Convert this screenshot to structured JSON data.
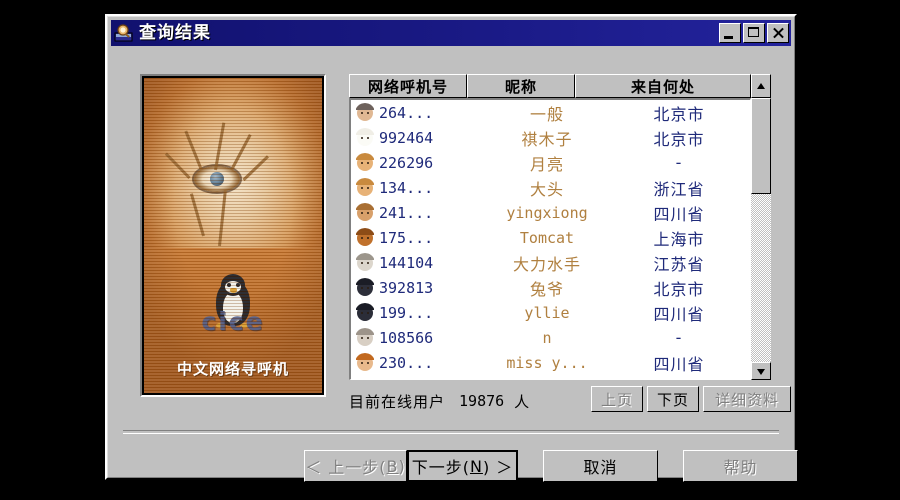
{
  "window": {
    "title": "查询结果",
    "icon": "search-book-icon",
    "controls": {
      "minimize": "minimize-icon",
      "maximize": "maximize-icon",
      "close": "close-icon"
    }
  },
  "art_panel": {
    "caption": "中文网络寻呼机",
    "logo_text": "cice",
    "mascot": "penguin-icon"
  },
  "table": {
    "headers": [
      "网络呼机号",
      "昵称",
      "来自何处"
    ],
    "sort_button": "sort-ascending-icon",
    "rows": [
      {
        "avatar": "avatar-face-icon",
        "id": "264...",
        "nick": "一般",
        "nick_cjk": true,
        "from": "北京市"
      },
      {
        "avatar": "avatar-cat-icon",
        "id": "992464",
        "nick": "祺木子",
        "nick_cjk": true,
        "from": "北京市"
      },
      {
        "avatar": "avatar-bear-icon",
        "id": "226296",
        "nick": "月亮",
        "nick_cjk": true,
        "from": "-"
      },
      {
        "avatar": "avatar-bear-icon",
        "id": "134...",
        "nick": "大头",
        "nick_cjk": true,
        "from": "浙江省"
      },
      {
        "avatar": "avatar-dog-icon",
        "id": "241...",
        "nick": "yingxiong",
        "nick_cjk": false,
        "from": "四川省"
      },
      {
        "avatar": "avatar-lion-icon",
        "id": "175...",
        "nick": "Tomcat",
        "nick_cjk": false,
        "from": "上海市"
      },
      {
        "avatar": "avatar-man-icon",
        "id": "144104",
        "nick": "大力水手",
        "nick_cjk": true,
        "from": "江苏省"
      },
      {
        "avatar": "avatar-bug-icon",
        "id": "392813",
        "nick": "兔爷",
        "nick_cjk": true,
        "from": "北京市"
      },
      {
        "avatar": "avatar-cow-icon",
        "id": "199...",
        "nick": "yllie",
        "nick_cjk": false,
        "from": "四川省"
      },
      {
        "avatar": "avatar-gray-icon",
        "id": "108566",
        "nick": "n",
        "nick_cjk": false,
        "from": "-"
      },
      {
        "avatar": "avatar-girl-icon",
        "id": "230...",
        "nick": "miss y...",
        "nick_cjk": false,
        "from": "四川省"
      }
    ]
  },
  "status": {
    "label": "目前在线用户",
    "count": "19876",
    "unit": "人"
  },
  "page_buttons": {
    "prev": "上页",
    "next": "下页",
    "details": "详细资料"
  },
  "dialog_buttons": {
    "back_prefix": "＜ 上一步(",
    "back_key": "B",
    "back_suffix": ")",
    "next_prefix": "下一步(",
    "next_key": "N",
    "next_suffix": ") ＞",
    "cancel": "取消",
    "help": "帮助"
  },
  "colors": {
    "title_bar": "#1a1a86",
    "dialog_face": "#c0c0c0",
    "id_text": "#1f2a7a",
    "nick_text": "#b08040",
    "from_text": "#1f2a7a",
    "art_orange": "#c8772f"
  }
}
